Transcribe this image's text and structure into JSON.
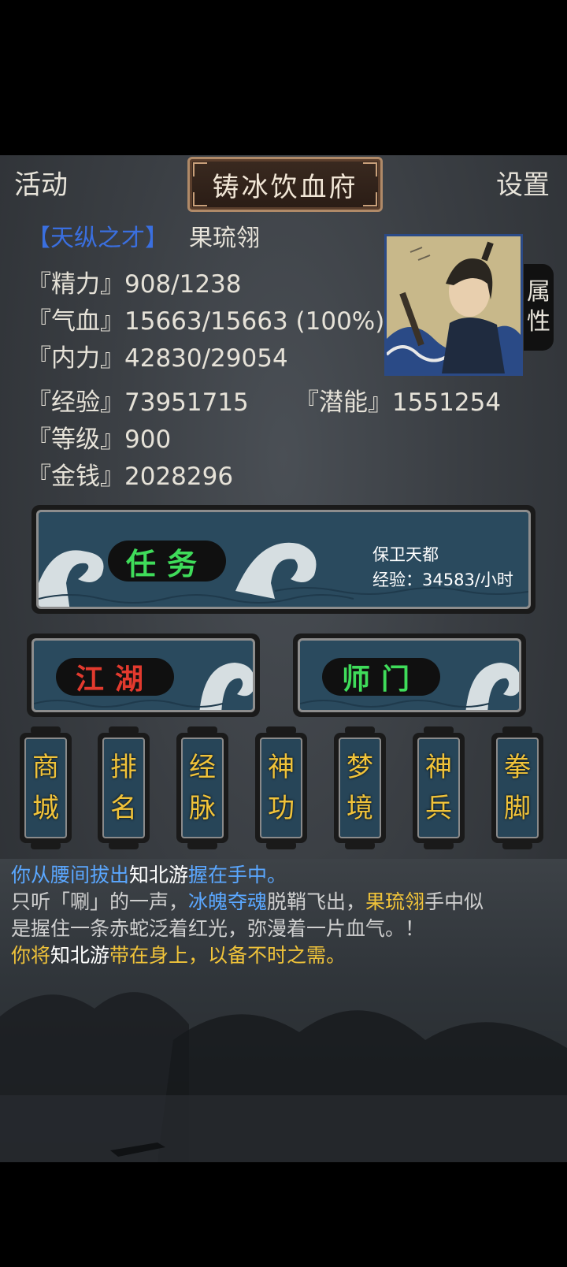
{
  "header": {
    "left_label": "活动",
    "title": "铸冰饮血府",
    "right_label": "设置"
  },
  "player": {
    "rank": "【天纵之才】",
    "name": "果琉翎"
  },
  "stats": {
    "energy": "『精力』908/1238",
    "health": "『气血』15663/15663 (100%)",
    "inner": "『内力』42830/29054",
    "exp": "『经验』73951715",
    "potential": "『潜能』1551254",
    "level": "『等级』900",
    "money": "『金钱』2028296"
  },
  "side_tab": {
    "line1": "属",
    "line2": "性"
  },
  "task": {
    "label": "任务",
    "info_title": "保卫天都",
    "info_exp": "经验：34583/小时"
  },
  "buttons": {
    "jianghu": "江湖",
    "shimen": "师门"
  },
  "tablets": [
    {
      "top": "商",
      "bottom": "城"
    },
    {
      "top": "排",
      "bottom": "名"
    },
    {
      "top": "经",
      "bottom": "脉"
    },
    {
      "top": "神",
      "bottom": "功"
    },
    {
      "top": "梦",
      "bottom": "境"
    },
    {
      "top": "神",
      "bottom": "兵"
    },
    {
      "top": "拳",
      "bottom": "脚"
    }
  ],
  "log": {
    "l1_a": "你从腰间拔出",
    "l1_b": "知北游",
    "l1_c": "握在手中。",
    "l2_a": "只听「唰」的一声，",
    "l2_b": "冰魄夺魂",
    "l2_c": "脱鞘飞出，",
    "l2_d": "果琉翎",
    "l2_e": "手中似",
    "l3": "是握住一条赤蛇泛着红光，弥漫着一片血气。！",
    "l4_a": "你将",
    "l4_b": "知北游",
    "l4_c": "带在身上，以备不时之需。"
  },
  "colors": {
    "rank": "#3a6fe0",
    "task_green": "#3fdc5a",
    "jianghu_red": "#e23a2e",
    "tablet_gold": "#f0c33a",
    "log_blue": "#5aa7ff"
  }
}
